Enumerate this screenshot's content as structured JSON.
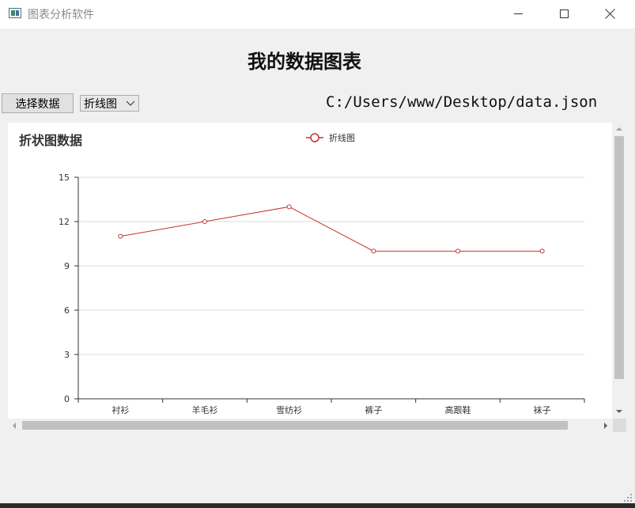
{
  "window": {
    "title": "图表分析软件",
    "minimize": "minimize",
    "maximize": "maximize",
    "close": "close"
  },
  "heading": "我的数据图表",
  "toolbar": {
    "select_button": "选择数据",
    "chart_type": {
      "selected": "折线图"
    },
    "file_path": "C:/Users/www/Desktop/data.json"
  },
  "chart_data": {
    "type": "line",
    "title": "折状图数据",
    "legend": {
      "position": "top-center",
      "entries": [
        "折线图"
      ]
    },
    "categories": [
      "衬衫",
      "羊毛衫",
      "雪纺衫",
      "裤子",
      "高跟鞋",
      "袜子"
    ],
    "series": [
      {
        "name": "折线图",
        "values": [
          11,
          12,
          13,
          10,
          10,
          10
        ],
        "color": "#c23531"
      }
    ],
    "ylim": [
      0,
      15
    ],
    "yticks": [
      0,
      3,
      6,
      9,
      12,
      15
    ],
    "grid": true
  },
  "icons": {
    "app": "app-window-icon",
    "dropdown": "chevron-down-icon",
    "resize": "resize-grip-icon"
  }
}
